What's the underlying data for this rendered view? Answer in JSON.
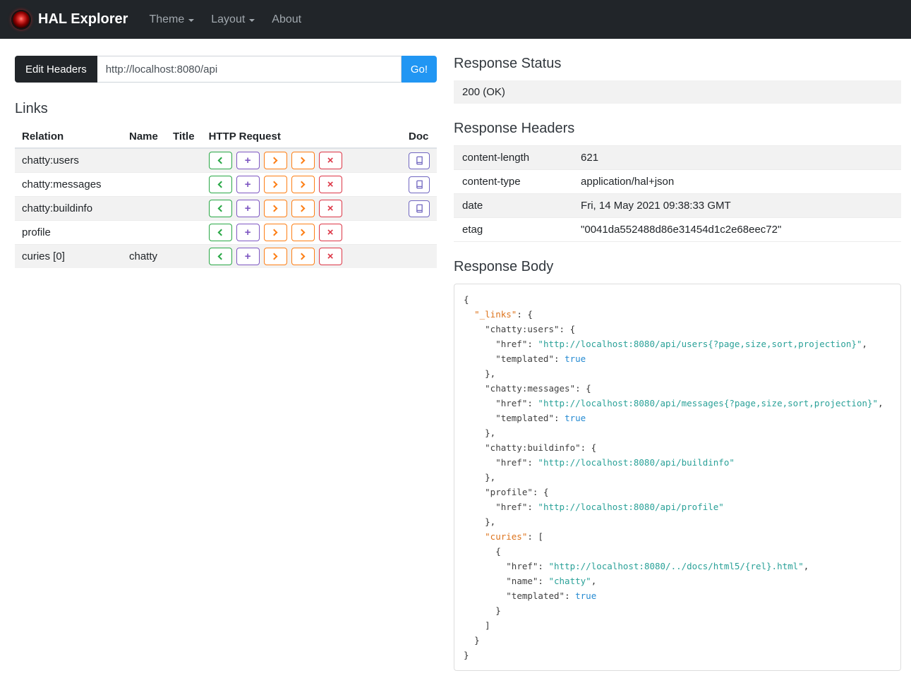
{
  "colors": {
    "navbar_bg": "#212529",
    "dark_button": "#212529",
    "accent_blue": "#2196f3",
    "stripe": "#f2f2f2",
    "get_green": "#28a745",
    "post_purple": "#7e57c2",
    "put_orange": "#fd7e14",
    "patch_orange": "#fd7e14",
    "delete_red": "#dc3545",
    "doc_purple": "#7066c0",
    "tok_key": "#3f3f3f",
    "tok_hal_key": "#dd731c",
    "tok_string": "#2aa198",
    "tok_bool": "#268bd2"
  },
  "navbar": {
    "brand": "HAL Explorer",
    "items": [
      {
        "label": "Theme",
        "has_caret": true
      },
      {
        "label": "Layout",
        "has_caret": true
      },
      {
        "label": "About",
        "has_caret": false
      }
    ]
  },
  "request_bar": {
    "edit_headers_label": "Edit Headers",
    "url_value": "http://localhost:8080/api",
    "go_label": "Go!"
  },
  "links_section": {
    "title": "Links",
    "columns": [
      "Relation",
      "Name",
      "Title",
      "HTTP Request",
      "Doc"
    ],
    "http_buttons": [
      {
        "name": "get-button",
        "kind": "chevron-left",
        "color": "#28a745"
      },
      {
        "name": "post-button",
        "kind": "plus",
        "glyph": "+",
        "color": "#7e57c2"
      },
      {
        "name": "put-button",
        "kind": "chevron-right",
        "color": "#fd7e14"
      },
      {
        "name": "patch-button",
        "kind": "chevron-right",
        "color": "#fd7e14"
      },
      {
        "name": "delete-button",
        "kind": "cross",
        "glyph": "×",
        "color": "#dc3545"
      }
    ],
    "rows": [
      {
        "relation": "chatty:users",
        "name": "",
        "title": "",
        "doc": true
      },
      {
        "relation": "chatty:messages",
        "name": "",
        "title": "",
        "doc": true
      },
      {
        "relation": "chatty:buildinfo",
        "name": "",
        "title": "",
        "doc": true
      },
      {
        "relation": "profile",
        "name": "",
        "title": "",
        "doc": false
      },
      {
        "relation": "curies [0]",
        "name": "chatty",
        "title": "",
        "doc": false
      }
    ]
  },
  "response_status": {
    "title": "Response Status",
    "value": "200 (OK)"
  },
  "response_headers": {
    "title": "Response Headers",
    "rows": [
      {
        "key": "content-length",
        "value": "621"
      },
      {
        "key": "content-type",
        "value": "application/hal+json"
      },
      {
        "key": "date",
        "value": "Fri, 14 May 2021 09:38:33 GMT"
      },
      {
        "key": "etag",
        "value": "\"0041da552488d86e31454d1c2e68eec72\""
      }
    ]
  },
  "response_body": {
    "title": "Response Body",
    "lines": [
      [
        [
          "p",
          "{"
        ]
      ],
      [
        [
          "p",
          "  "
        ],
        [
          "hk",
          "\"_links\""
        ],
        [
          "p",
          ": {"
        ]
      ],
      [
        [
          "p",
          "    "
        ],
        [
          "k",
          "\"chatty:users\""
        ],
        [
          "p",
          ": {"
        ]
      ],
      [
        [
          "p",
          "      "
        ],
        [
          "k",
          "\"href\""
        ],
        [
          "p",
          ": "
        ],
        [
          "s",
          "\"http://localhost:8080/api/users{?page,size,sort,projection}\""
        ],
        [
          "p",
          ","
        ]
      ],
      [
        [
          "p",
          "      "
        ],
        [
          "k",
          "\"templated\""
        ],
        [
          "p",
          ": "
        ],
        [
          "b",
          "true"
        ]
      ],
      [
        [
          "p",
          "    },"
        ]
      ],
      [
        [
          "p",
          "    "
        ],
        [
          "k",
          "\"chatty:messages\""
        ],
        [
          "p",
          ": {"
        ]
      ],
      [
        [
          "p",
          "      "
        ],
        [
          "k",
          "\"href\""
        ],
        [
          "p",
          ": "
        ],
        [
          "s",
          "\"http://localhost:8080/api/messages{?page,size,sort,projection}\""
        ],
        [
          "p",
          ","
        ]
      ],
      [
        [
          "p",
          "      "
        ],
        [
          "k",
          "\"templated\""
        ],
        [
          "p",
          ": "
        ],
        [
          "b",
          "true"
        ]
      ],
      [
        [
          "p",
          "    },"
        ]
      ],
      [
        [
          "p",
          "    "
        ],
        [
          "k",
          "\"chatty:buildinfo\""
        ],
        [
          "p",
          ": {"
        ]
      ],
      [
        [
          "p",
          "      "
        ],
        [
          "k",
          "\"href\""
        ],
        [
          "p",
          ": "
        ],
        [
          "s",
          "\"http://localhost:8080/api/buildinfo\""
        ]
      ],
      [
        [
          "p",
          "    },"
        ]
      ],
      [
        [
          "p",
          "    "
        ],
        [
          "k",
          "\"profile\""
        ],
        [
          "p",
          ": {"
        ]
      ],
      [
        [
          "p",
          "      "
        ],
        [
          "k",
          "\"href\""
        ],
        [
          "p",
          ": "
        ],
        [
          "s",
          "\"http://localhost:8080/api/profile\""
        ]
      ],
      [
        [
          "p",
          "    },"
        ]
      ],
      [
        [
          "p",
          "    "
        ],
        [
          "hk",
          "\"curies\""
        ],
        [
          "p",
          ": ["
        ]
      ],
      [
        [
          "p",
          "      {"
        ]
      ],
      [
        [
          "p",
          "        "
        ],
        [
          "k",
          "\"href\""
        ],
        [
          "p",
          ": "
        ],
        [
          "s",
          "\"http://localhost:8080/../docs/html5/{rel}.html\""
        ],
        [
          "p",
          ","
        ]
      ],
      [
        [
          "p",
          "        "
        ],
        [
          "k",
          "\"name\""
        ],
        [
          "p",
          ": "
        ],
        [
          "s",
          "\"chatty\""
        ],
        [
          "p",
          ","
        ]
      ],
      [
        [
          "p",
          "        "
        ],
        [
          "k",
          "\"templated\""
        ],
        [
          "p",
          ": "
        ],
        [
          "b",
          "true"
        ]
      ],
      [
        [
          "p",
          "      }"
        ]
      ],
      [
        [
          "p",
          "    ]"
        ]
      ],
      [
        [
          "p",
          "  }"
        ]
      ],
      [
        [
          "p",
          "}"
        ]
      ]
    ]
  }
}
